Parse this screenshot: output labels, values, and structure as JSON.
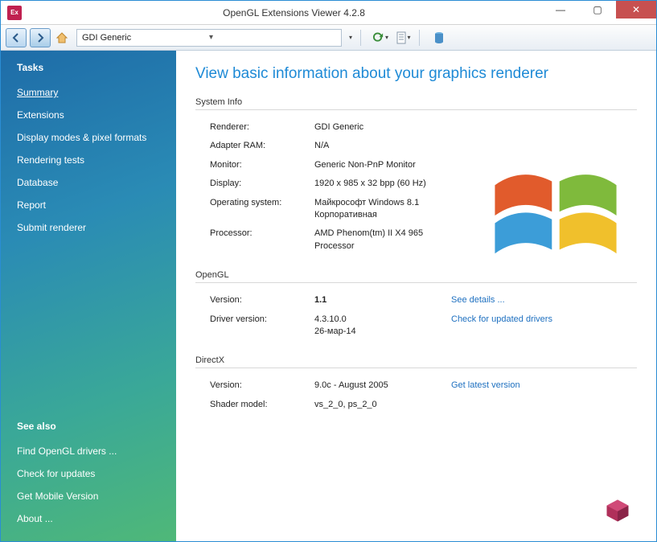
{
  "window": {
    "title": "OpenGL Extensions Viewer 4.2.8"
  },
  "toolbar": {
    "renderer_selected": "GDI Generic"
  },
  "sidebar": {
    "tasks_header": "Tasks",
    "tasks": [
      {
        "label": "Summary",
        "active": true
      },
      {
        "label": "Extensions"
      },
      {
        "label": "Display modes & pixel formats"
      },
      {
        "label": "Rendering tests"
      },
      {
        "label": "Database"
      },
      {
        "label": "Report"
      },
      {
        "label": "Submit renderer"
      }
    ],
    "seealso_header": "See also",
    "seealso": [
      {
        "label": "Find OpenGL drivers ..."
      },
      {
        "label": "Check for updates"
      },
      {
        "label": "Get Mobile Version"
      },
      {
        "label": "About ..."
      }
    ]
  },
  "content": {
    "heading": "View basic information about your graphics renderer",
    "system_info": {
      "title": "System Info",
      "rows": {
        "renderer_label": "Renderer:",
        "renderer_value": "GDI Generic",
        "ram_label": "Adapter RAM:",
        "ram_value": "N/A",
        "monitor_label": "Monitor:",
        "monitor_value": "Generic Non-PnP Monitor",
        "display_label": "Display:",
        "display_value": "1920 x 985 x 32 bpp (60 Hz)",
        "os_label": "Operating system:",
        "os_value": "Майкрософт Windows 8.1 Корпоративная",
        "cpu_label": "Processor:",
        "cpu_value": "AMD Phenom(tm) II X4 965 Processor"
      }
    },
    "opengl": {
      "title": "OpenGL",
      "version_label": "Version:",
      "version_value": "1.1",
      "version_link": "See details ...",
      "driver_label": "Driver version:",
      "driver_value": "4.3.10.0\n26-мар-14",
      "driver_link": "Check for updated drivers"
    },
    "directx": {
      "title": "DirectX",
      "version_label": "Version:",
      "version_value": "9.0c - August 2005",
      "version_link": "Get latest version",
      "shader_label": "Shader model:",
      "shader_value": "vs_2_0, ps_2_0"
    }
  }
}
